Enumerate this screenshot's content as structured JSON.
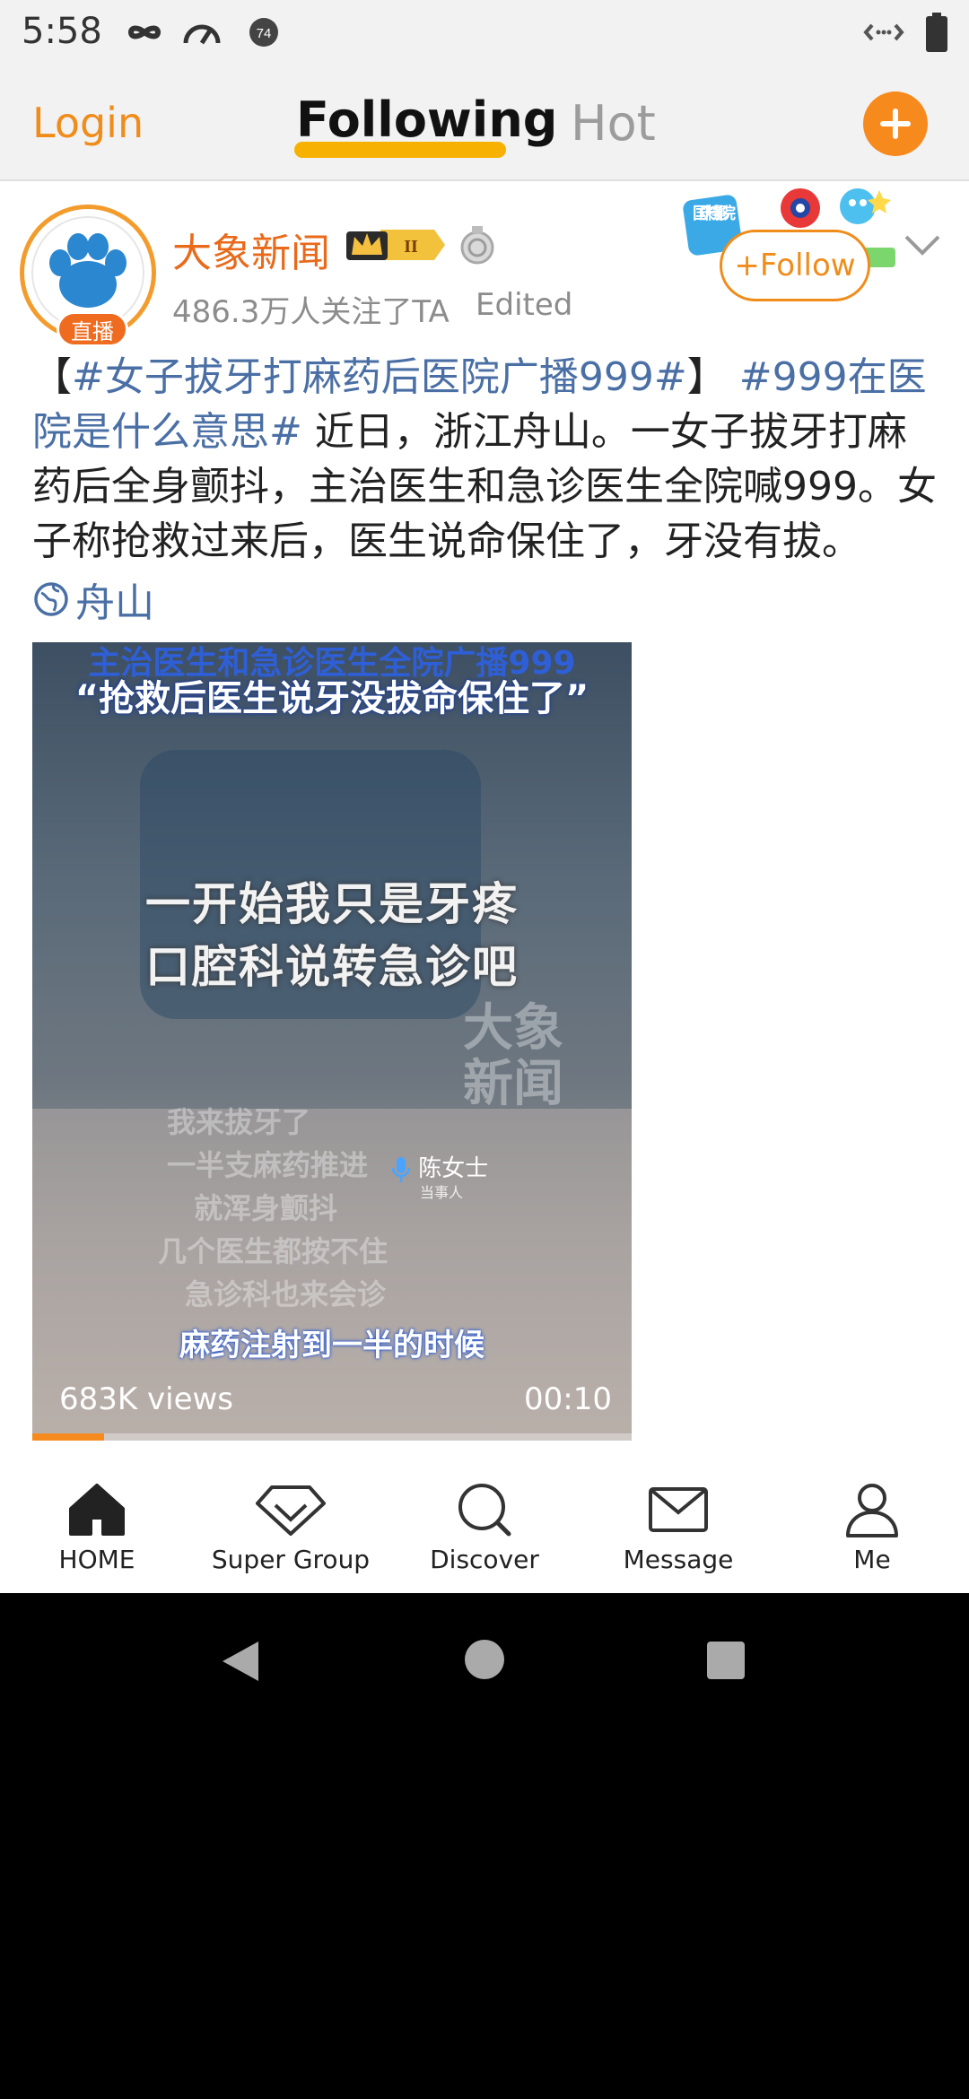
{
  "status_bar": {
    "time": "5:58",
    "notification_badge": "74"
  },
  "top_nav": {
    "login_label": "Login",
    "tabs": [
      {
        "label": "Following",
        "active": true
      },
      {
        "label": "Hot",
        "active": false
      }
    ],
    "compose_icon": "plus-icon"
  },
  "post": {
    "author": "大象新闻",
    "avatar_badge": "直播",
    "vip_level": "II",
    "medal_icon": "medal-icon",
    "followers": "486.3万人关注了TA",
    "edited": "Edited",
    "follow_label": "Follow",
    "promo_badge": "国庆档影院",
    "text": {
      "hashtag1": "#女子拔牙打麻药后医院广播999#",
      "hashtag2": "#999在医院是什么意思#",
      "body": " 近日，浙江舟山。一女子拔牙打麻药后全身颤抖，主治医生和急诊医生全院喊999。女子称抢救过来后，医生说命保住了，牙没有拔。",
      "bracket_open": "【",
      "bracket_close": "】"
    },
    "location": "舟山"
  },
  "video": {
    "caption_top1": "主治医生和急诊医生全院广播999",
    "caption_top2": "“抢救后医生说牙没拔命保住了”",
    "caption_mid1": "一开始我只是牙疼",
    "caption_mid2": "口腔科说转急诊吧",
    "watermark": "大象新闻",
    "speaker_name": "陈女士",
    "speaker_role": "当事人",
    "ghost_lines": [
      "我来拔牙了",
      "一半支麻药推进",
      "就浑身颤抖",
      "几个医生都按不住",
      "急诊科也来会诊"
    ],
    "caption_bottom": "麻药注射到一半的时候",
    "views": "683K views",
    "duration": "00:10",
    "progress": 0.12
  },
  "bottom_nav": [
    {
      "label": "HOME",
      "icon": "home-icon"
    },
    {
      "label": "Super Group",
      "icon": "diamond-icon"
    },
    {
      "label": "Discover",
      "icon": "search-icon"
    },
    {
      "label": "Message",
      "icon": "mail-icon"
    },
    {
      "label": "Me",
      "icon": "person-icon"
    }
  ],
  "colors": {
    "accent_orange": "#f08c1a",
    "hashtag_blue": "#4a6fa5",
    "tab_underline": "#f7b100"
  }
}
